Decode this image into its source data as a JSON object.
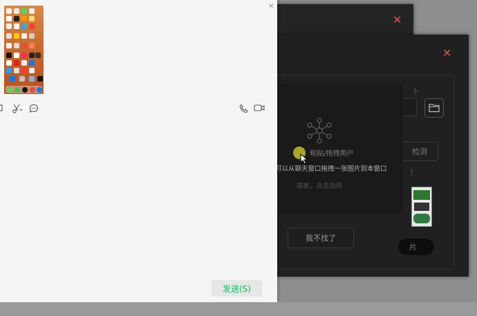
{
  "dialog": {
    "close_glyph": "✕",
    "front_label_fragment": "卜",
    "detect_label": "检测",
    "small_label": "|",
    "pill_label": "片",
    "cancel_label": "我不找了"
  },
  "drop_zone": {
    "title": "粘贴/拖拽用户",
    "hint": "可以从聊天窗口拖拽一张图片到本窗口",
    "sub": "或者，点击选择"
  },
  "chat": {
    "send_label": "发送(S)"
  },
  "colors": {
    "accent_green": "#07c160",
    "close_red": "#d9534f"
  }
}
